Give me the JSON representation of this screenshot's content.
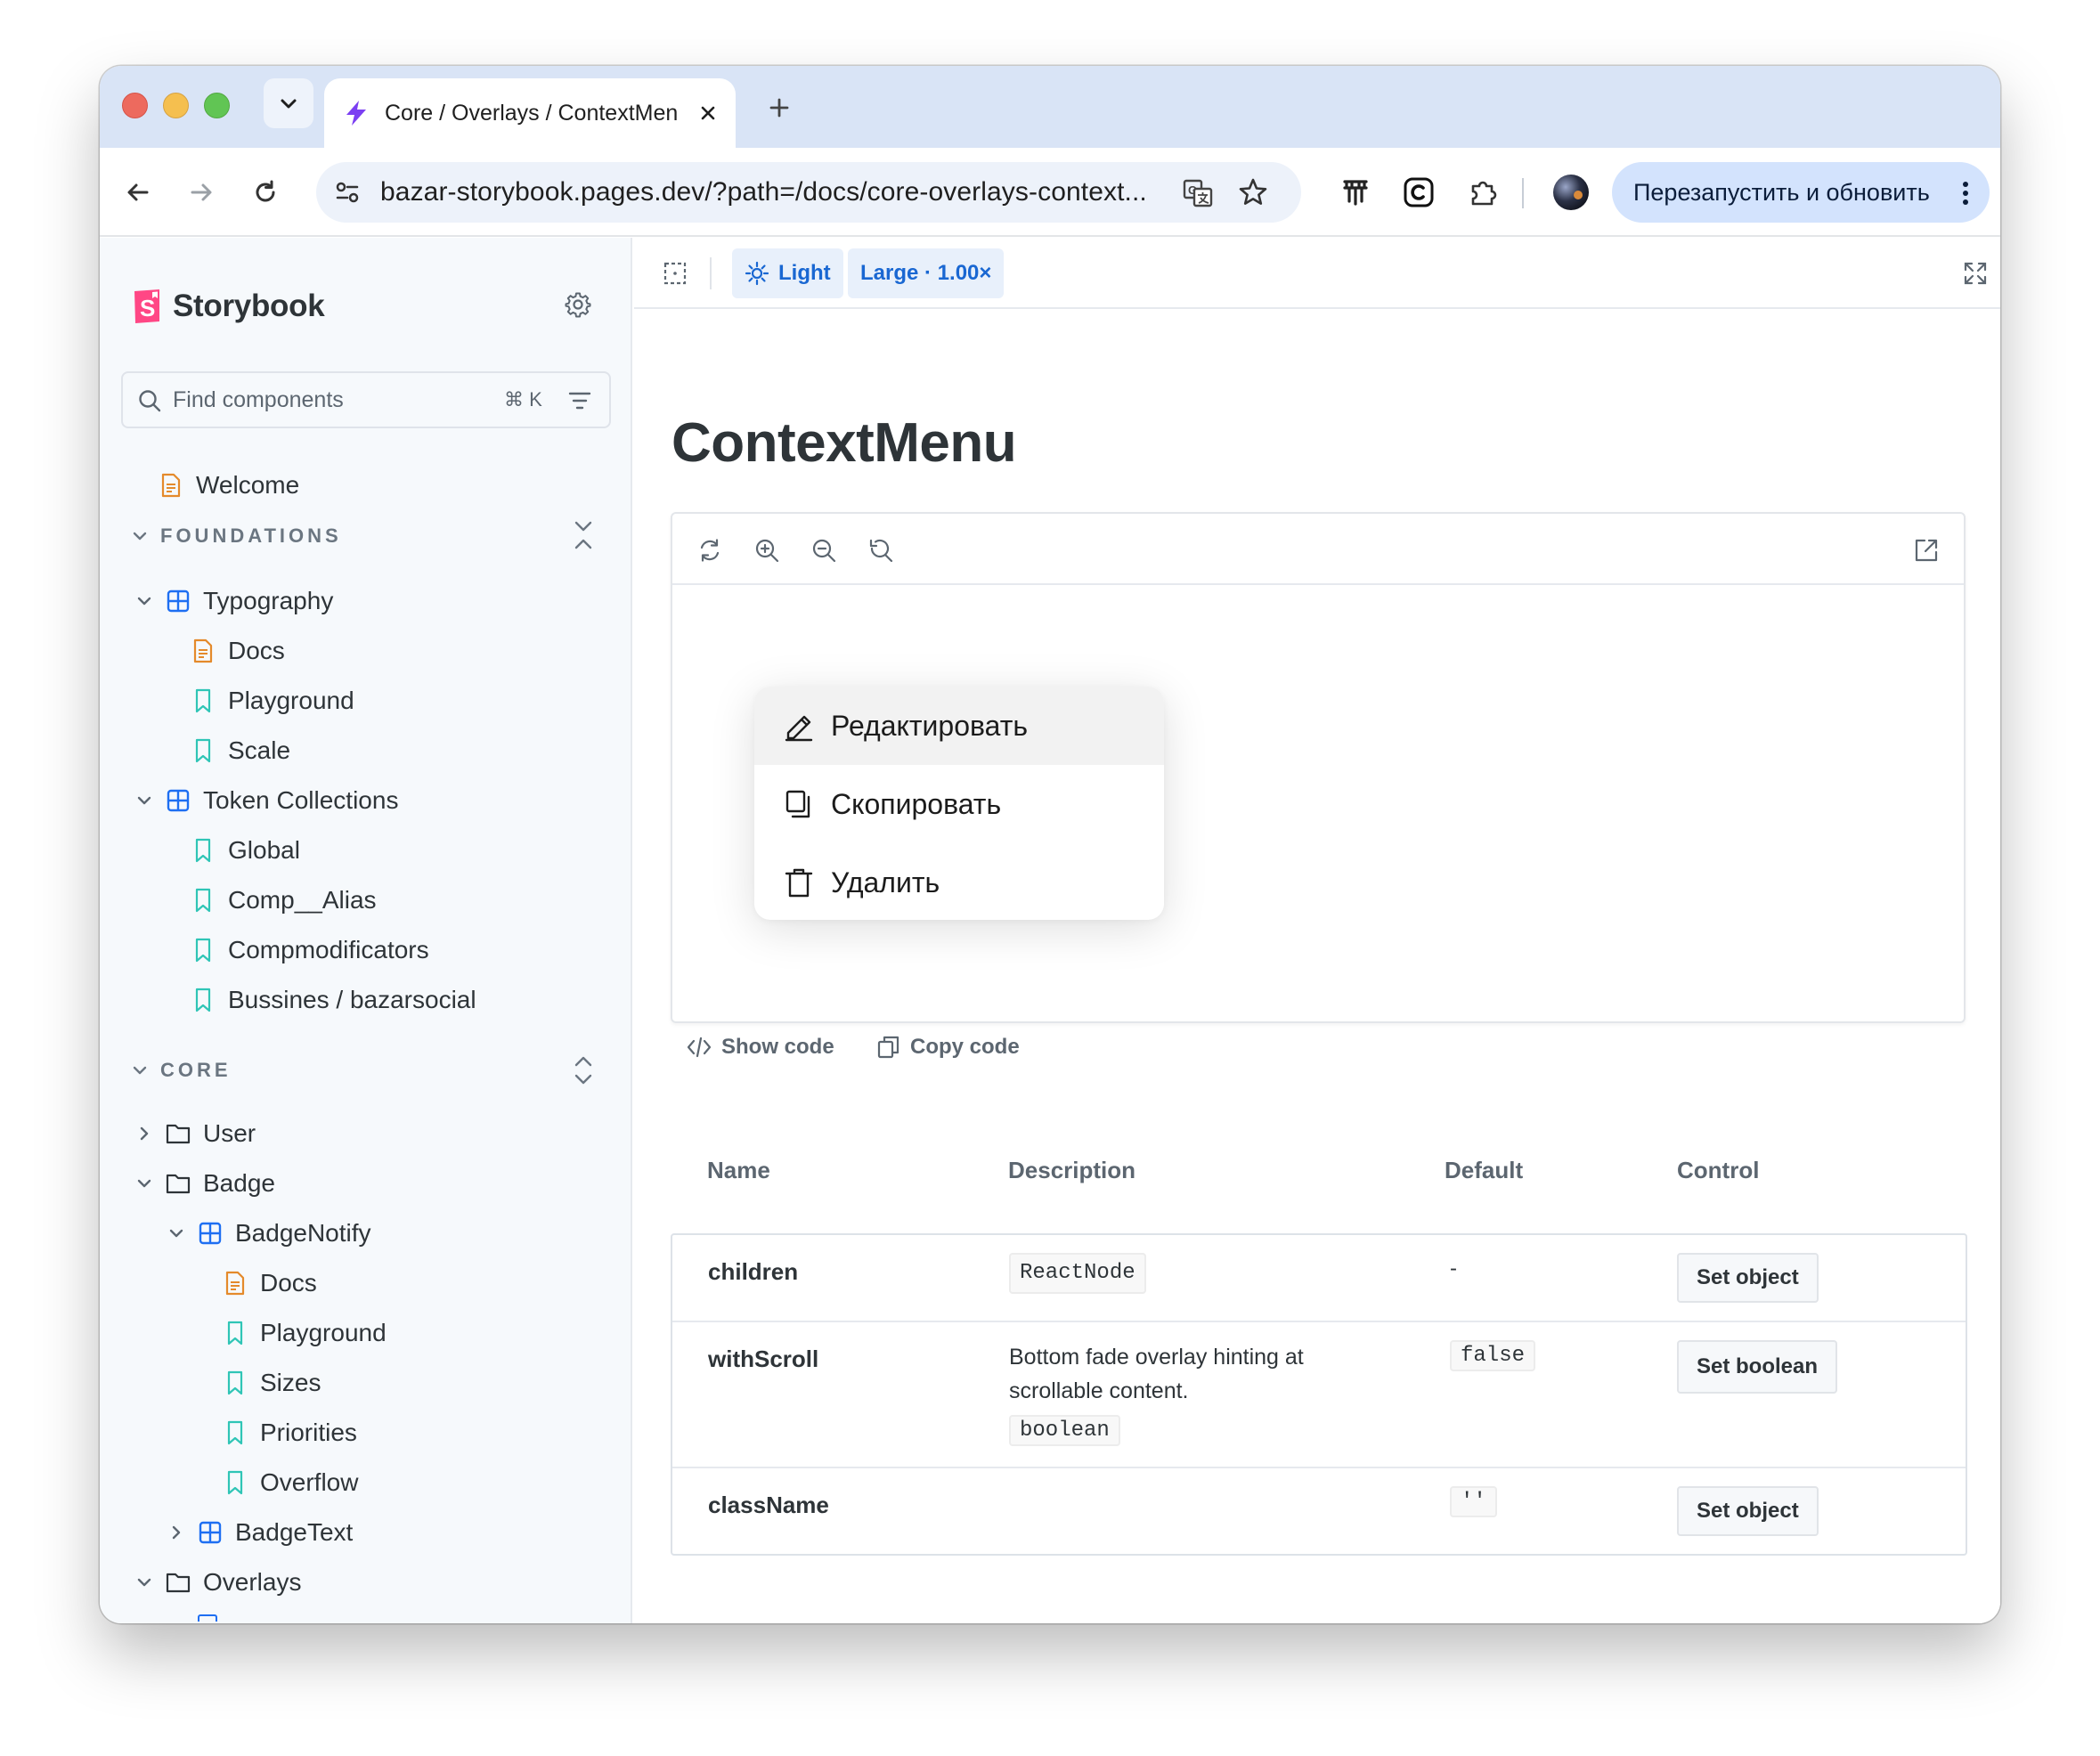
{
  "browser": {
    "tab_title": "Core / Overlays / ContextMenu",
    "url": "bazar-storybook.pages.dev/?path=/docs/core-overlays-context...",
    "restart_label": "Перезапустить и обновить",
    "accent": "#d9e4f6"
  },
  "sidebar": {
    "brand": "Storybook",
    "search_placeholder": "Find components",
    "search_shortcut": "⌘ K",
    "welcome": "Welcome",
    "foundations": {
      "title": "FOUNDATIONS",
      "typography": "Typography",
      "typography_items": [
        "Docs",
        "Playground",
        "Scale"
      ],
      "token_collections": "Token Collections",
      "token_items": [
        "Global",
        "Comp__Alias",
        "Compmodificators",
        "Bussines / bazarsocial"
      ]
    },
    "core": {
      "title": "CORE",
      "user": "User",
      "badge": "Badge",
      "badge_notify": "BadgeNotify",
      "badge_notify_items": [
        "Docs",
        "Playground",
        "Sizes",
        "Priorities",
        "Overflow"
      ],
      "badge_text": "BadgeText",
      "overlays": "Overlays"
    }
  },
  "main": {
    "theme_label": "Light",
    "viewport_label": "Large · 1.00×",
    "title": "ContextMenu",
    "menu_items": [
      "Редактировать",
      "Скопировать",
      "Удалить"
    ],
    "show_code": "Show code",
    "copy_code": "Copy code",
    "table": {
      "headers": [
        "Name",
        "Description",
        "Default",
        "Control"
      ],
      "rows": [
        {
          "name": "children",
          "description": "",
          "type": "ReactNode",
          "default": "-",
          "control": "Set object"
        },
        {
          "name": "withScroll",
          "description": "Bottom fade overlay hinting at scrollable content.",
          "type": "boolean",
          "default": "false",
          "control": "Set boolean"
        },
        {
          "name": "className",
          "description": "",
          "type": "",
          "default": "''",
          "control": "Set object"
        }
      ]
    }
  }
}
